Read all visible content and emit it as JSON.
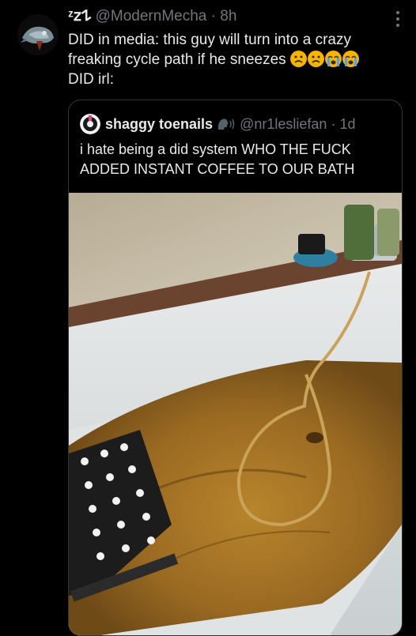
{
  "post": {
    "display_name": "ᶻ𝗓𐰁",
    "handle": "@ModernMecha",
    "separator": "·",
    "time": "8h",
    "text_line1": "DID in media: this guy will turn into a crazy",
    "text_line2": "freaking cycle path if he sneezes",
    "text_line3": "DID irl:",
    "emojis": [
      "anguished-face",
      "anguished-face",
      "crying-face",
      "crying-face"
    ]
  },
  "quote": {
    "display_name": "shaggy toenails",
    "badge_icon": "speaking-head-icon",
    "handle": "@nr1lesliefan",
    "separator": "·",
    "time": "1d",
    "text_line1": "i hate being a did system WHO THE FUCK",
    "text_line2": "ADDED INSTANT COFFEE TO OUR BATH"
  },
  "colors": {
    "background": "#000000",
    "text_primary": "#e7e9ea",
    "text_secondary": "#71767b",
    "border": "#333639",
    "emoji_yellow": "#f4b400"
  }
}
